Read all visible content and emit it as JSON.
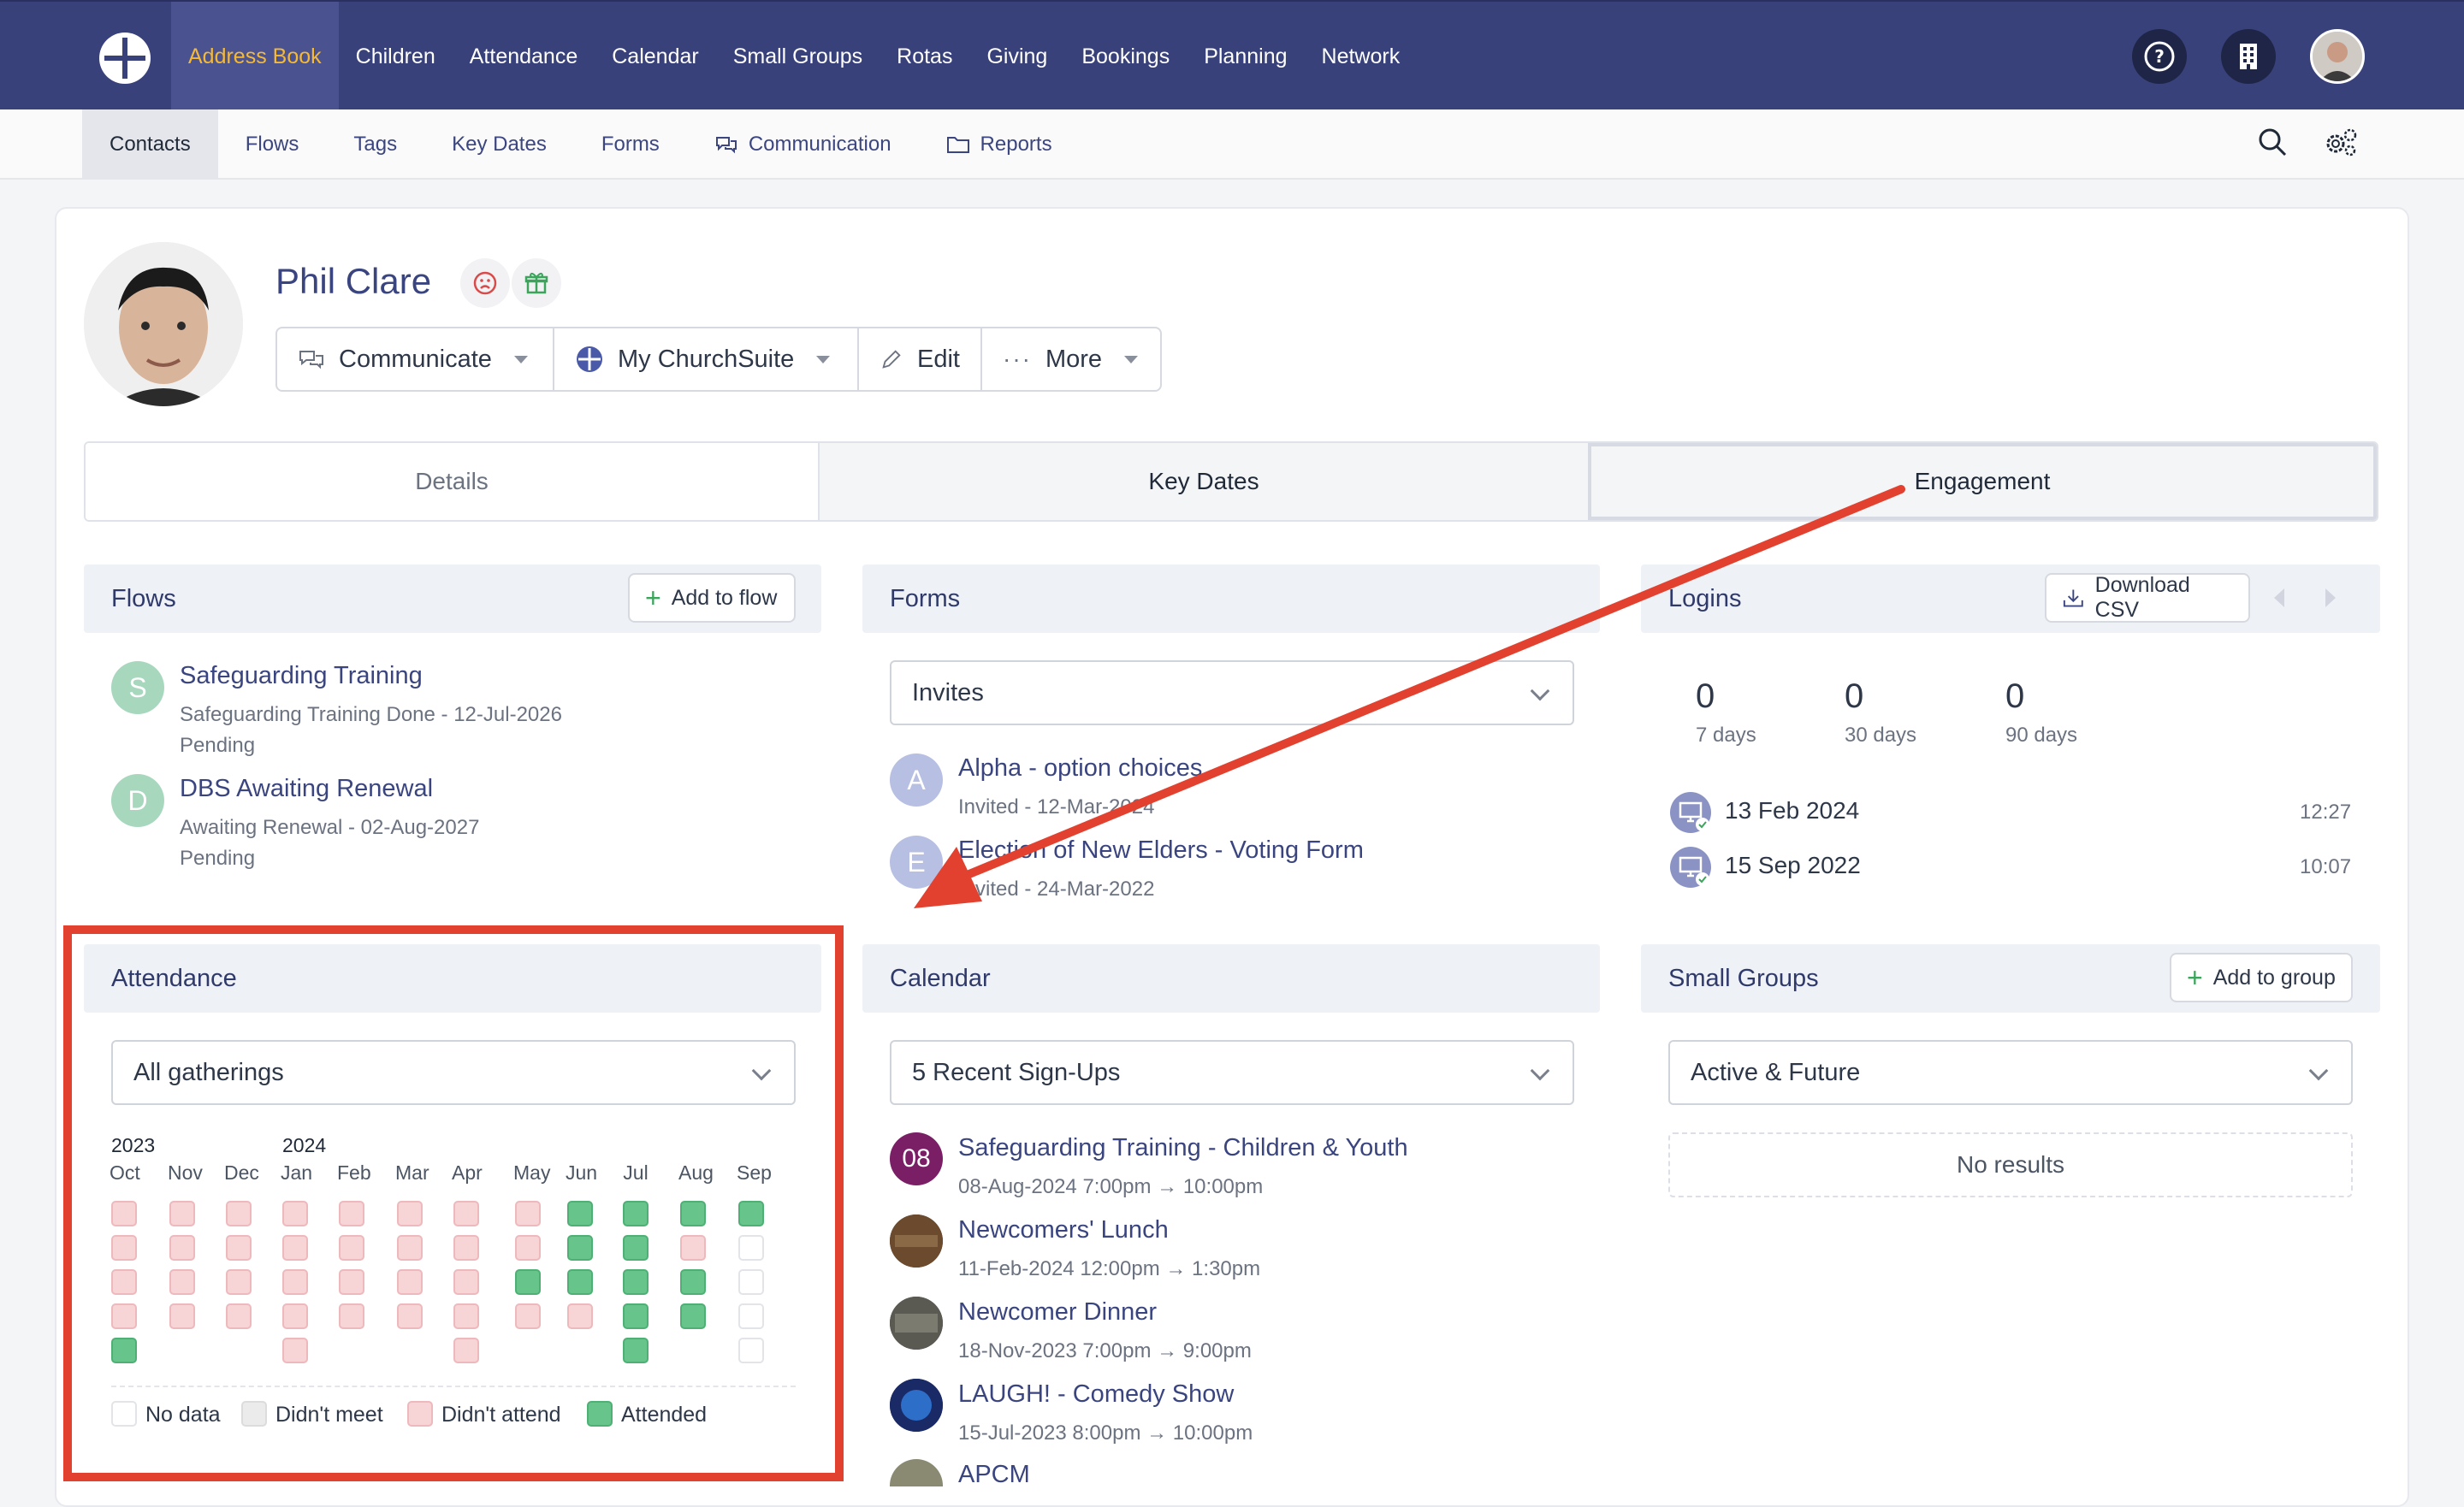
{
  "topnav": {
    "items": [
      "Address Book",
      "Children",
      "Attendance",
      "Calendar",
      "Small Groups",
      "Rotas",
      "Giving",
      "Bookings",
      "Planning",
      "Network"
    ],
    "active": "Address Book"
  },
  "subnav": {
    "items": [
      "Contacts",
      "Flows",
      "Tags",
      "Key Dates",
      "Forms",
      "Communication",
      "Reports"
    ],
    "active": "Contacts"
  },
  "profile": {
    "name": "Phil Clare",
    "buttons": {
      "communicate": "Communicate",
      "mychurchsuite": "My ChurchSuite",
      "edit": "Edit",
      "more": "More"
    }
  },
  "tabs": [
    "Details",
    "Key Dates",
    "Engagement"
  ],
  "flows": {
    "title": "Flows",
    "add": "Add to flow",
    "items": [
      {
        "initial": "S",
        "name": "Safeguarding Training",
        "detail": "Safeguarding Training Done - 12-Jul-2026",
        "status": "Pending"
      },
      {
        "initial": "D",
        "name": "DBS Awaiting Renewal",
        "detail": "Awaiting Renewal - 02-Aug-2027",
        "status": "Pending"
      }
    ]
  },
  "forms": {
    "title": "Forms",
    "select": "Invites",
    "items": [
      {
        "initial": "A",
        "name": "Alpha - option choices",
        "detail": "Invited - 12-Mar-2024"
      },
      {
        "initial": "E",
        "name": "Election of New Elders - Voting Form",
        "detail": "Invited - 24-Mar-2022"
      }
    ]
  },
  "logins": {
    "title": "Logins",
    "download": "Download CSV",
    "stats": [
      {
        "value": "0",
        "label": "7 days"
      },
      {
        "value": "0",
        "label": "30 days"
      },
      {
        "value": "0",
        "label": "90 days"
      }
    ],
    "entries": [
      {
        "date": "13 Feb 2024",
        "time": "12:27"
      },
      {
        "date": "15 Sep 2022",
        "time": "10:07"
      }
    ]
  },
  "attendance": {
    "title": "Attendance",
    "select": "All gatherings",
    "years": [
      "2023",
      "2024"
    ],
    "months": [
      "Oct",
      "Nov",
      "Dec",
      "Jan",
      "Feb",
      "Mar",
      "Apr",
      "May",
      "Jun",
      "Jul",
      "Aug",
      "Sep"
    ],
    "grid": [
      [
        "p",
        "p",
        "p",
        "p",
        "g"
      ],
      [
        "p",
        "p",
        "p",
        "p"
      ],
      [
        "p",
        "p",
        "p",
        "p"
      ],
      [
        "p",
        "p",
        "p",
        "p",
        "p"
      ],
      [
        "p",
        "p",
        "p",
        "p"
      ],
      [
        "p",
        "p",
        "p",
        "p"
      ],
      [
        "p",
        "p",
        "p",
        "p",
        "p"
      ],
      [
        "p",
        "p",
        "g",
        "p"
      ],
      [
        "g",
        "g",
        "g",
        "p"
      ],
      [
        "g",
        "g",
        "g",
        "g",
        "g"
      ],
      [
        "g",
        "p",
        "g",
        "g"
      ],
      [
        "g",
        "e",
        "e",
        "e",
        "e"
      ]
    ],
    "legend": [
      "No data",
      "Didn't meet",
      "Didn't attend",
      "Attended"
    ],
    "colors": {
      "attended": "#67c48b",
      "didnt_attend": "#f7d4d6",
      "didnt_meet": "#ebebeb",
      "no_data": "#ffffff"
    }
  },
  "calendar": {
    "title": "Calendar",
    "select": "5 Recent Sign-Ups",
    "items": [
      {
        "badge": "08",
        "name": "Safeguarding Training - Children & Youth",
        "detail": "08-Aug-2024 7:00pm → 10:00pm"
      },
      {
        "badge": "",
        "name": "Newcomers' Lunch",
        "detail": "11-Feb-2024 12:00pm → 1:30pm"
      },
      {
        "badge": "",
        "name": "Newcomer Dinner",
        "detail": "18-Nov-2023 7:00pm → 9:00pm"
      },
      {
        "badge": "",
        "name": "LAUGH! - Comedy Show",
        "detail": "15-Jul-2023 8:00pm → 10:00pm"
      },
      {
        "badge": "",
        "name": "APCM",
        "detail": ""
      }
    ]
  },
  "smallgroups": {
    "title": "Small Groups",
    "add": "Add to group",
    "select": "Active & Future",
    "empty": "No results"
  },
  "accent": {
    "nav": "#38417a",
    "active": "#f5b935",
    "highlight": "#e2412f"
  }
}
